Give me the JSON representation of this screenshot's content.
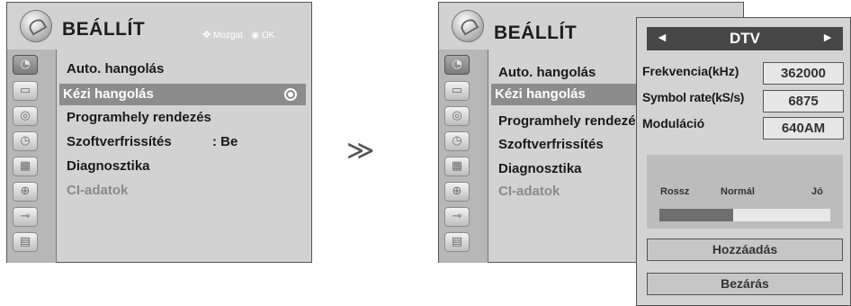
{
  "left_menu": {
    "title": "BEÁLLÍT",
    "nav_hint": "Mozgat.",
    "ok_hint": "OK",
    "items": [
      {
        "label": "Auto. hangolás"
      },
      {
        "label": "Kézi hangolás"
      },
      {
        "label": "Programhely rendezés"
      },
      {
        "label": "Szoftverfrissítés",
        "value": ": Be"
      },
      {
        "label": "Diagnosztika"
      },
      {
        "label": "CI-adatok"
      }
    ],
    "selected_index": 1
  },
  "transition_symbol": "≫",
  "right_menu": {
    "title": "BEÁLLÍT",
    "items": [
      {
        "label": "Auto. hangolás"
      },
      {
        "label": "Kézi hangolás"
      },
      {
        "label": "Programhely rendezés"
      },
      {
        "label": "Szoftverfrissítés"
      },
      {
        "label": "Diagnosztika"
      },
      {
        "label": "CI-adatok"
      }
    ]
  },
  "side_icons": [
    "satellite-dish-icon",
    "tv-screen-icon",
    "speaker-icon",
    "clock-icon",
    "image-icon",
    "lock-icon",
    "input-plug-icon",
    "clapperboard-icon"
  ],
  "popup": {
    "mode_label": "DTV",
    "left_arrow": "◄",
    "right_arrow": "►",
    "fields": [
      {
        "label": "Frekvencia(kHz)",
        "value": "362000"
      },
      {
        "label": "Symbol rate(kS/s)",
        "value": "6875"
      },
      {
        "label": "Moduláció",
        "value": "640AM"
      }
    ],
    "signal": {
      "bad": "Rossz",
      "normal": "Normál",
      "good": "Jó",
      "level_fraction": 0.43
    },
    "add_button": "Hozzáadás",
    "close_button": "Bezárás"
  }
}
